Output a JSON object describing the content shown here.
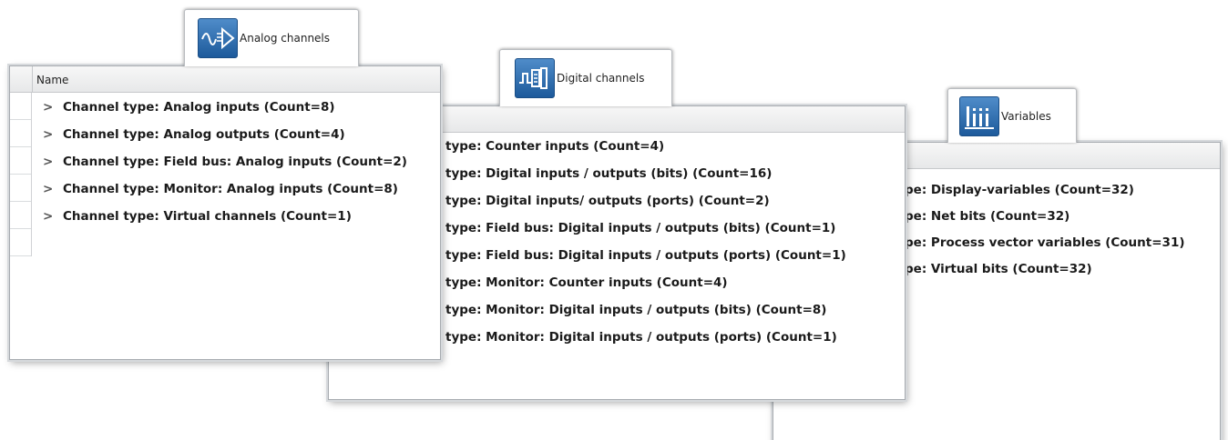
{
  "analog": {
    "tab_label": "Analog channels",
    "icon": "analog-channels-icon",
    "header_label": "Name",
    "rows": [
      "Channel type: Analog inputs (Count=8)",
      "Channel type: Analog outputs (Count=4)",
      "Channel type: Field bus: Analog inputs (Count=2)",
      "Channel type: Monitor: Analog inputs (Count=8)",
      "Channel type: Virtual channels (Count=1)"
    ]
  },
  "digital": {
    "tab_label": "Digital channels",
    "icon": "digital-channels-icon",
    "rows": [
      "type: Counter inputs (Count=4)",
      "type: Digital inputs / outputs (bits) (Count=16)",
      "type: Digital inputs/ outputs (ports) (Count=2)",
      "type: Field bus: Digital inputs / outputs (bits) (Count=1)",
      "type: Field bus: Digital inputs / outputs (ports) (Count=1)",
      "type: Monitor: Counter inputs (Count=4)",
      "type: Monitor: Digital inputs / outputs (bits) (Count=8)",
      "type: Monitor: Digital inputs / outputs (ports) (Count=1)"
    ]
  },
  "variables": {
    "tab_label": "Variables",
    "icon": "variables-icon",
    "rows": [
      "pe: Display-variables (Count=32)",
      "pe: Net bits (Count=32)",
      "pe: Process vector variables (Count=31)",
      "pe: Virtual bits (Count=32)"
    ]
  },
  "chevron_glyph": ">",
  "colors": {
    "icon_blue": "#2a68a8",
    "header_bg": "#ececec",
    "panel_border": "#a7abb0"
  }
}
